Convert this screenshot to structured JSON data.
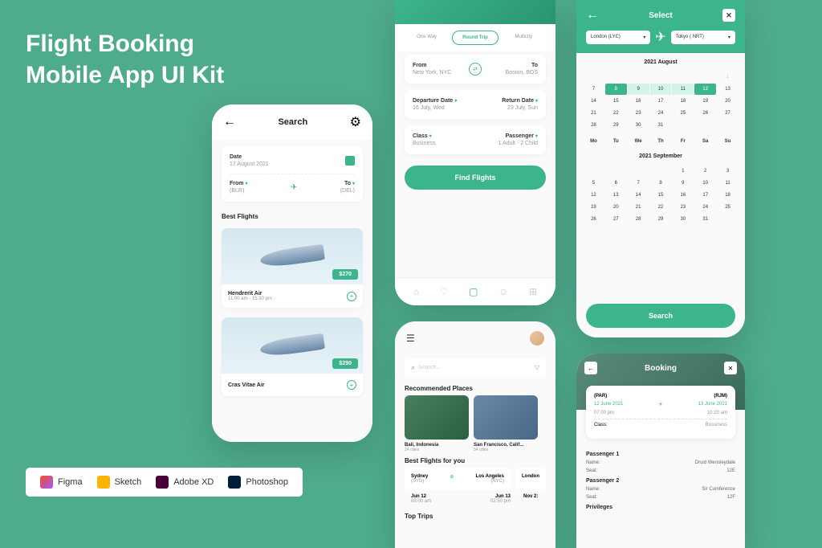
{
  "title_line1": "Flight Booking",
  "title_line2": "Mobile App UI Kit",
  "screen1": {
    "header": "Search",
    "date_label": "Date",
    "date_value": "17 August 2021",
    "from_label": "From",
    "from_value": "(BLR)",
    "to_label": "To",
    "to_value": "(DEL)",
    "best_flights": "Best Flights",
    "flight1_name": "Hendrerit Air",
    "flight1_time": "11:00 am - 15:30 pm",
    "flight1_price": "$270",
    "flight2_name": "Cras Vitae Air",
    "flight2_price": "$290"
  },
  "screen2": {
    "tab1": "One Way",
    "tab2": "Round Trip",
    "tab3": "Multicity",
    "from_label": "From",
    "from_value": "New York, NYC",
    "to_label": "To",
    "to_value": "Boston, BOS",
    "dep_label": "Departure Date",
    "dep_value": "16 July, Wed",
    "ret_label": "Return Date",
    "ret_value": "23 July, Sun",
    "class_label": "Class",
    "class_value": "Business",
    "pass_label": "Passenger",
    "pass_value": "1 Adult - 2 Child",
    "button": "Find Flights"
  },
  "screen3": {
    "title": "Select",
    "from": "London (LYC)",
    "to": "Tokyo ( NRT)",
    "month1": "2021 August",
    "month2": "2021 September",
    "dow": [
      "Mo",
      "Tu",
      "We",
      "Th",
      "Fr",
      "Sa",
      "Su"
    ],
    "aug_week1": [
      "",
      "",
      "",
      "",
      "",
      "",
      "1"
    ],
    "aug_week2": [
      "7",
      "8",
      "9",
      "10",
      "11",
      "12",
      "13"
    ],
    "aug_week3": [
      "14",
      "15",
      "16",
      "17",
      "18",
      "19",
      "20"
    ],
    "aug_week4": [
      "21",
      "22",
      "23",
      "24",
      "25",
      "26",
      "27"
    ],
    "aug_week5": [
      "28",
      "29",
      "30",
      "31",
      "",
      "",
      ""
    ],
    "sep_week1": [
      "",
      "",
      "",
      "",
      "1",
      "2",
      "3"
    ],
    "sep_week2": [
      "5",
      "6",
      "7",
      "8",
      "9",
      "10",
      "11"
    ],
    "sep_week3": [
      "12",
      "13",
      "14",
      "15",
      "16",
      "17",
      "18"
    ],
    "sep_week4": [
      "19",
      "20",
      "21",
      "22",
      "23",
      "24",
      "25"
    ],
    "sep_week5": [
      "26",
      "27",
      "28",
      "29",
      "30",
      "31",
      ""
    ],
    "search_btn": "Search"
  },
  "screen4": {
    "search_placeholder": "Search...",
    "rec_title": "Recommended Places",
    "place1_name": "Bali, Indonesia",
    "place1_cities": "14 cities",
    "place2_name": "San Francisco, Calif...",
    "place2_cities": "54 cities",
    "best_title": "Best Flights for you",
    "f1_from": "Sydney",
    "f1_from_code": "(SYD)",
    "f1_to": "Los Angeles",
    "f1_to_code": "(NYC)",
    "f2_city": "London",
    "f1_date1": "Jun 12",
    "f1_time1": "09:00 am",
    "f1_date2": "Jun 13",
    "f1_time2": "02:50 pm",
    "f2_date": "Nov 2:",
    "top_trips": "Top Trips"
  },
  "screen5": {
    "title": "Booking",
    "from_code": "(PAR)",
    "to_code": "(RJM)",
    "from_date": "12 June 2021",
    "to_date": "13 June 2021",
    "from_time": "07:00 pm",
    "to_time": "10:20 am",
    "class_label": "Class:",
    "class_value": "Bussiness",
    "p1_title": "Passenger 1",
    "p1_name_label": "Name:",
    "p1_name": "Druid Wensleydale",
    "p1_seat_label": "Seat:",
    "p1_seat": "12E",
    "p2_title": "Passenger 2",
    "p2_name_label": "Name:",
    "p2_name": "Sir Cumference",
    "p2_seat_label": "Seat:",
    "p2_seat": "12F",
    "priv_title": "Privileges"
  },
  "tools": {
    "figma": "Figma",
    "sketch": "Sketch",
    "xd": "Adobe XD",
    "ps": "Photoshop"
  }
}
